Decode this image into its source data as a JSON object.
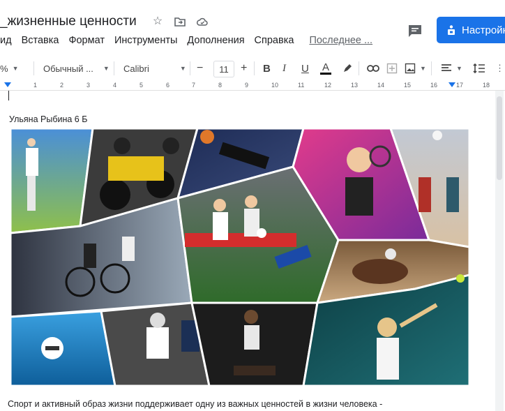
{
  "doc": {
    "title": "_жизненные ценности",
    "author_line": "Ульяна Рыбина 6 Б",
    "body_line": "Спорт и активный образ жизни поддерживает одну из важных ценностей в жизни человека -"
  },
  "menu": {
    "items": [
      "ид",
      "Вставка",
      "Формат",
      "Инструменты",
      "Дополнения",
      "Справка"
    ],
    "last_edit": "Последнее ..."
  },
  "share": {
    "label": "Настройки"
  },
  "toolbar": {
    "zoom": "%",
    "style": "Обычный ...",
    "font": "Calibri",
    "font_size": "11",
    "minus": "−",
    "plus": "+",
    "bold": "B",
    "italic": "I",
    "underline": "U",
    "text_color": "A"
  },
  "ruler": {
    "ticks": [
      "1",
      "2",
      "3",
      "4",
      "5",
      "6",
      "7",
      "8",
      "9",
      "10",
      "11",
      "12",
      "13",
      "14",
      "15",
      "16",
      "17",
      "18"
    ]
  },
  "colors": {
    "accent": "#1a73e8",
    "text": "#202124",
    "muted": "#5f6368"
  },
  "icons": {
    "star": "star-icon",
    "folder": "move-to-folder-icon",
    "cloud": "cloud-status-icon",
    "comments": "comment-icon",
    "lock": "lock-icon"
  }
}
